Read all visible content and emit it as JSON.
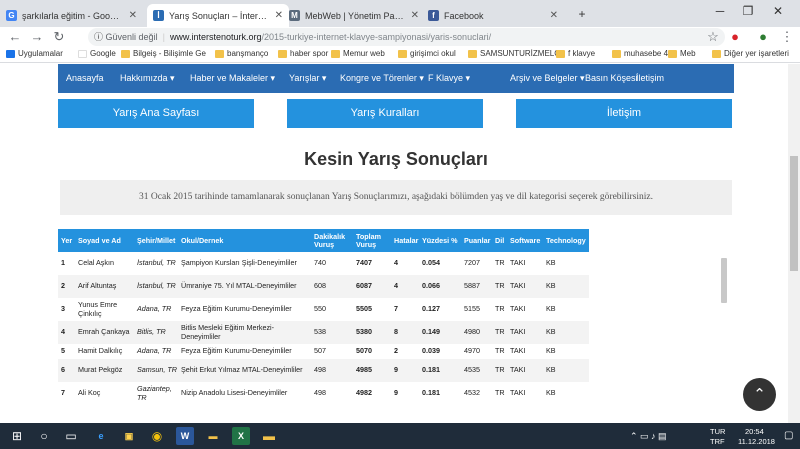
{
  "browser": {
    "tabs": [
      {
        "title": "şarkılarla eğitim - Google'da Ara",
        "fav": "G",
        "favcolor": "#4285f4",
        "active": false
      },
      {
        "title": "Yarış Sonuçları – İntersteno-Türk",
        "fav": "İ",
        "favcolor": "#2b6cb3",
        "active": true
      },
      {
        "title": "MebWeb | Yönetim Paneli",
        "fav": "M",
        "favcolor": "#5b6b7d",
        "active": false
      },
      {
        "title": "Facebook",
        "fav": "f",
        "favcolor": "#3b5998",
        "active": false
      }
    ],
    "secure_label": "Güvenli değil",
    "url_host": "www.interstenoturk.org",
    "url_path": "/2015-turkiye-internet-klavye-sampiyonasi/yaris-sonuclari/",
    "bookmarks": [
      "Uygulamalar",
      "Google",
      "Bilgeiş - Bilişimle Ge",
      "banşmanço",
      "haber spor",
      "Memur web",
      "girişimci okul",
      "SAMSUNTURİZMELÇ",
      "f klavye",
      "muhasebe 4.0",
      "Meb"
    ],
    "other_bookmarks": "Diğer yer işaretleri"
  },
  "site": {
    "nav": [
      "Anasayfa",
      "Hakkımızda",
      "Haber ve Makaleler",
      "Yarışlar",
      "Kongre ve Törenler",
      "F Klavye",
      "Arşiv ve Belgeler",
      "Basın Köşesi",
      "İletişim"
    ],
    "buttons": [
      "Yarış Ana Sayfası",
      "Yarış Kuralları",
      "İletişim"
    ],
    "title": "Kesin Yarış Sonuçları",
    "info": "31 Ocak 2015 tarihinde tamamlanarak sonuçlanan Yarış Sonuçlarımızı, aşağıdaki bölümden yaş ve dil kategorisi seçerek görebilirsiniz."
  },
  "table": {
    "headers": [
      "Yer",
      "Soyad ve Ad",
      "Şehir/Millet",
      "Okul/Dernek",
      "Dakikalık Vuruş",
      "Toplam Vuruş",
      "Hatalar",
      "Yüzdesi %",
      "Puanlar",
      "Dil",
      "Software",
      "Technology"
    ],
    "rows": [
      [
        "1",
        "Celal Aşkın",
        "İstanbul, TR",
        "Şampiyon Kursları Şişli-Deneyimliler",
        "740",
        "7407",
        "4",
        "0.054",
        "7207",
        "TR",
        "TAKI",
        "KB"
      ],
      [
        "2",
        "Arif Altuntaş",
        "İstanbul, TR",
        "Ümraniye 75. Yıl MTAL-Deneyimliler",
        "608",
        "6087",
        "4",
        "0.066",
        "5887",
        "TR",
        "TAKI",
        "KB"
      ],
      [
        "3",
        "Yunus Emre Çinkılıç",
        "Adana, TR",
        "Feyza Eğitim Kurumu-Deneyimliler",
        "550",
        "5505",
        "7",
        "0.127",
        "5155",
        "TR",
        "TAKI",
        "KB"
      ],
      [
        "4",
        "Emrah Çankaya",
        "Bitlis, TR",
        "Bitlis Mesleki Eğitim Merkezi-Deneyimliler",
        "538",
        "5380",
        "8",
        "0.149",
        "4980",
        "TR",
        "TAKI",
        "KB"
      ],
      [
        "5",
        "Hamit Dalkılıç",
        "Adana, TR",
        "Feyza Eğitim Kurumu-Deneyimliler",
        "507",
        "5070",
        "2",
        "0.039",
        "4970",
        "TR",
        "TAKI",
        "KB"
      ],
      [
        "6",
        "Murat Pekgöz",
        "Samsun, TR",
        "Şehit Erkut Yılmaz MTAL-Deneyimliler",
        "498",
        "4985",
        "9",
        "0.181",
        "4535",
        "TR",
        "TAKI",
        "KB"
      ],
      [
        "7",
        "Ali Koç",
        "Gaziantep, TR",
        "Nizip Anadolu Lisesi-Deneyimliler",
        "498",
        "4982",
        "9",
        "0.181",
        "4532",
        "TR",
        "TAKI",
        "KB"
      ]
    ]
  },
  "taskbar": {
    "lang": "TUR",
    "lang2": "TRF",
    "time": "20:54",
    "date": "11.12.2018"
  }
}
